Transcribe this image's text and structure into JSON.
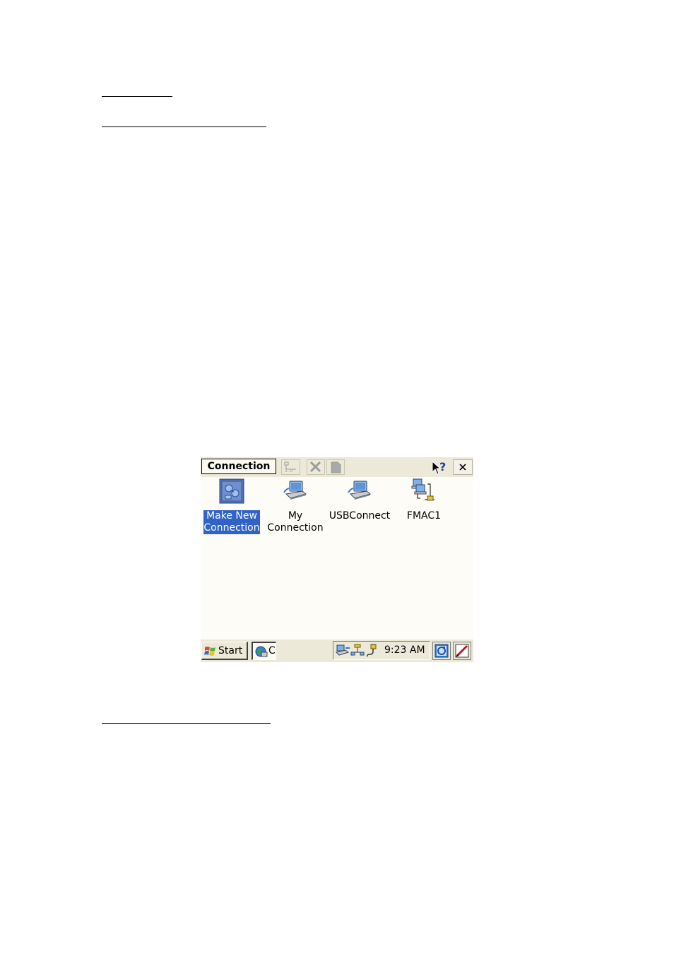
{
  "window": {
    "title": "Connection"
  },
  "items": [
    {
      "label": "Make New\nConnection",
      "icon": "make-new-connection-icon",
      "selected": true
    },
    {
      "label": "My\nConnection",
      "icon": "laptop-connection-icon",
      "selected": false
    },
    {
      "label": "USBConnect",
      "icon": "laptop-connection-icon",
      "selected": false
    },
    {
      "label": "FMAC1",
      "icon": "network-connection-icon",
      "selected": false
    }
  ],
  "taskbar": {
    "start_label": "Start",
    "task_label": "C",
    "clock": "9:23 AM"
  },
  "colors": {
    "selection": "#3162c5",
    "toolbar": "#ece9d8",
    "background": "#fdfcf7"
  }
}
